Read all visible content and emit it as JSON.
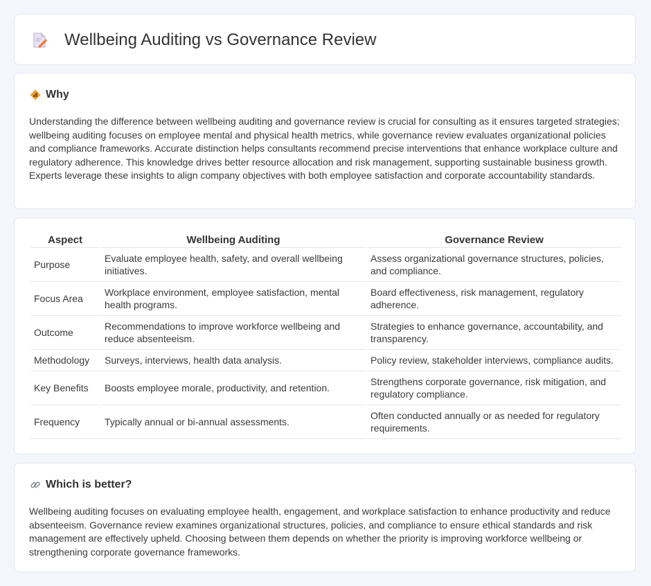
{
  "header": {
    "title": "Wellbeing Auditing vs Governance Review",
    "icon": "document-pencil-icon"
  },
  "why": {
    "heading": "Why",
    "icon": "diamond-signal-icon",
    "text": "Understanding the difference between wellbeing auditing and governance review is crucial for consulting as it ensures targeted strategies; wellbeing auditing focuses on employee mental and physical health metrics, while governance review evaluates organizational policies and compliance frameworks. Accurate distinction helps consultants recommend precise interventions that enhance workplace culture and regulatory adherence. This knowledge drives better resource allocation and risk management, supporting sustainable business growth. Experts leverage these insights to align company objectives with both employee satisfaction and corporate accountability standards."
  },
  "table": {
    "headers": [
      "Aspect",
      "Wellbeing Auditing",
      "Governance Review"
    ],
    "rows": [
      [
        "Purpose",
        "Evaluate employee health, safety, and overall wellbeing initiatives.",
        "Assess organizational governance structures, policies, and compliance."
      ],
      [
        "Focus Area",
        "Workplace environment, employee satisfaction, mental health programs.",
        "Board effectiveness, risk management, regulatory adherence."
      ],
      [
        "Outcome",
        "Recommendations to improve workforce wellbeing and reduce absenteeism.",
        "Strategies to enhance governance, accountability, and transparency."
      ],
      [
        "Methodology",
        "Surveys, interviews, health data analysis.",
        "Policy review, stakeholder interviews, compliance audits."
      ],
      [
        "Key Benefits",
        "Boosts employee morale, productivity, and retention.",
        "Strengthens corporate governance, risk mitigation, and regulatory compliance."
      ],
      [
        "Frequency",
        "Typically annual or bi-annual assessments.",
        "Often conducted annually or as needed for regulatory requirements."
      ]
    ]
  },
  "which": {
    "heading": "Which is better?",
    "icon": "link-icon",
    "text": "Wellbeing auditing focuses on evaluating employee health, engagement, and workplace satisfaction to enhance productivity and reduce absenteeism. Governance review examines organizational structures, policies, and compliance to ensure ethical standards and risk management are effectively upheld. Choosing between them depends on whether the priority is improving workforce wellbeing or strengthening corporate governance frameworks."
  },
  "colors": {
    "background": "#f4f6fb",
    "card": "#ffffff",
    "border": "#e3e6ee",
    "accent_orange": "#f0a030"
  }
}
